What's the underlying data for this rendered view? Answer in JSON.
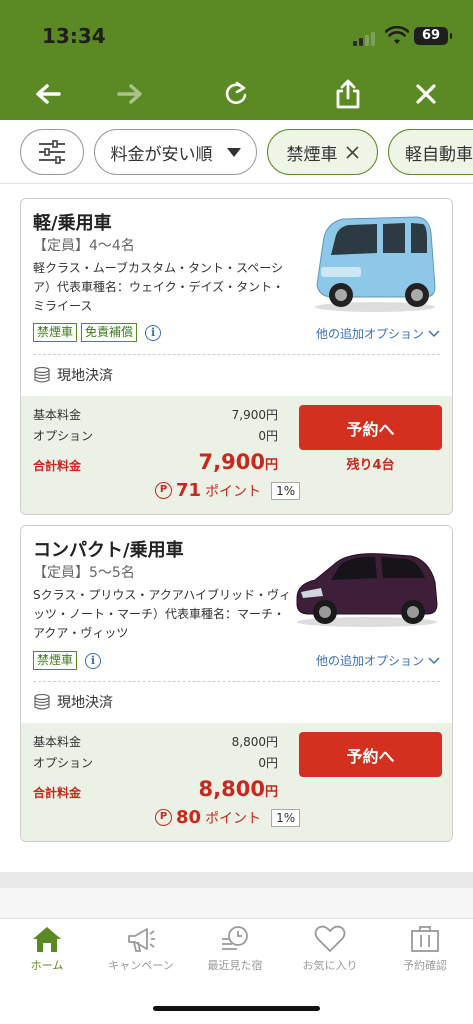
{
  "status": {
    "time": "13:34",
    "battery": "69"
  },
  "toolbar": {
    "icons": [
      "back-arrow-icon",
      "forward-arrow-icon",
      "reload-icon",
      "share-icon",
      "close-icon"
    ]
  },
  "filters": {
    "settings_icon": "sliders-icon",
    "sort_label": "料金が安い順",
    "chips": [
      "禁煙車",
      "軽自動車"
    ]
  },
  "cards": [
    {
      "title": "軽/乗用車",
      "capacity": "【定員】4〜4名",
      "description": "軽クラス・ムーブカスタム・タント・スペーシア）代表車種名：ウェイク・デイズ・タント・ミライース",
      "tags": [
        "禁煙車",
        "免責補償"
      ],
      "more_options": "他の追加オプション",
      "payment": "現地決済",
      "base_label": "基本料金",
      "base_value": "7,900円",
      "option_label": "オプション",
      "option_value": "0円",
      "total_label": "合計料金",
      "total_value": "7,900",
      "total_unit": "円",
      "points": "71",
      "points_label": "ポイント",
      "points_rate": "1%",
      "book_label": "予約へ",
      "remaining": "残り4台",
      "car_color": "#8ec8e8"
    },
    {
      "title": "コンパクト/乗用車",
      "capacity": "【定員】5〜5名",
      "description": "Sクラス・プリウス・アクアハイブリッド・ヴィッツ・ノート・マーチ）代表車種名：マーチ・アクア・ヴィッツ",
      "tags": [
        "禁煙車"
      ],
      "more_options": "他の追加オプション",
      "payment": "現地決済",
      "base_label": "基本料金",
      "base_value": "8,800円",
      "option_label": "オプション",
      "option_value": "0円",
      "total_label": "合計料金",
      "total_value": "8,800",
      "total_unit": "円",
      "points": "80",
      "points_label": "ポイント",
      "points_rate": "1%",
      "book_label": "予約へ",
      "car_color": "#3d1f3a"
    }
  ],
  "tabbar": {
    "items": [
      {
        "label": "ホーム",
        "icon": "home-icon",
        "active": true
      },
      {
        "label": "キャンペーン",
        "icon": "megaphone-icon",
        "active": false
      },
      {
        "label": "最近見た宿",
        "icon": "history-icon",
        "active": false
      },
      {
        "label": "お気に入り",
        "icon": "heart-icon",
        "active": false
      },
      {
        "label": "予約確認",
        "icon": "reservation-icon",
        "active": false
      }
    ]
  },
  "colors": {
    "brand_green": "#5b8a25",
    "accent_red": "#d4301f",
    "link_blue": "#3d6fb6"
  }
}
